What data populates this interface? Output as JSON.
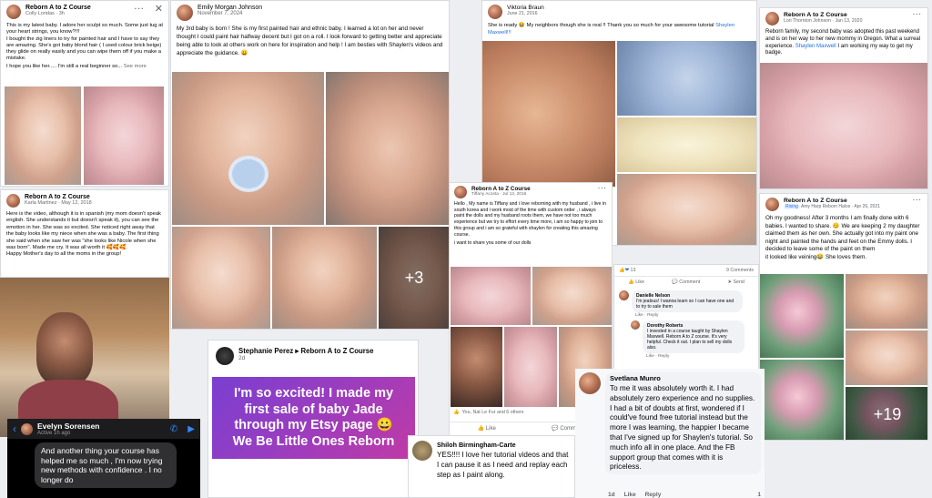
{
  "p1": {
    "group": "Reborn A to Z Course",
    "author": "Colly Loridas",
    "time": "3h",
    "text": "This is my latest baby. I adore her sculpt so much. Some just tug at your heart strings, you know?!!!\nI bought the zig liners to try for painted hair and I have to say they are amazing. She's got baby blond  hair ( I used colour brick beige) they glide on really easily and you can wipe them off if you make a mistake.",
    "text2": "I hope you like her..... I'm still a real beginner so...",
    "see_more": "See more"
  },
  "p2": {
    "author": "Emily Morgan Johnson",
    "time": "November 7, 2024",
    "text": "My 3rd baby is born !  She is my first painted hair and ethnic baby. I learned a lot on her and never thought I could paint hair halfway decent but I got on a roll. I look forward to getting better and appreciate being able to look at others work on here for inspiration and help ! I am besties with Shaylen's videos and appreciate the guidance. 😀",
    "more_count": "+3"
  },
  "p3": {
    "author": "Viktoria Braun",
    "time": "June 21, 2016",
    "text": "She is ready 😆 My neighbors though she is real !! Thank you so much for your awesome tutorial",
    "link": "Shaylen Maxwell!!!"
  },
  "p4": {
    "group": "Reborn A to Z Course",
    "author": "Lori Thornton Johnson",
    "time": "Jan 13, 2020",
    "text": "Reborn family, my second baby was adopted this past weekend and is on her way to her new mommy in Oregon.  What a surreal experience.",
    "link": "Shaylen Maxwell",
    "text2": "I am working my way to get my badge."
  },
  "p5": {
    "group": "Reborn A to Z Course",
    "author": "Karla Martinez",
    "time": "May 12, 2018",
    "text": "Here is the video, although it is in spanish (my mom doesn't speak english. She understands it but doesn't speak it), you can see the emotion in her. She was so excited. She noticed right away that the baby looks like my niece when she was a baby. The first thing she said when she saw her was \"she looks like Nicole when she was born\". Made me cry. It was all worth it 🥰🥰🥰.\nHappy Mother's day to all the moms in the group!"
  },
  "p6": {
    "group": "Reborn A to Z Course",
    "author": "Tiffany Acosta",
    "time": "Jul 13, 2016",
    "text": "Hello , My name is Tiffany and i love reborning with my husband , i live in south korea and i work most of the time with custom order , i always paint the dolls and my husband roots them, we  have not too much experience but we try to effort every time more, i am so happy to join to this group and i am so grateful with shaylen for creating this amazing course.",
    "text2": "i want to share you some of our dolls",
    "reactions": "You, Nat Le Fur and 6 others",
    "like": "Like",
    "comment": "Comment"
  },
  "p7": {
    "reactions": "13",
    "comments": "9 Comments",
    "like": "Like",
    "comment": "Comment",
    "send": "Send",
    "c1_name": "Danielle Nelson",
    "c1_text": "I'm jealous!  I wanna learn so I can have one and to try to sale them",
    "c1_like": "Like",
    "c1_reply": "Reply",
    "c2_name": "Dorothy Roberts",
    "c2_text": "I invested in a course taught by Shaylen Maxwell. Reborn A to Z course. It's very helpful. Check it out. I plan to sell my dolls also.",
    "c2_like": "Like",
    "c2_reply": "Reply"
  },
  "p8": {
    "group": "Reborn A to Z Course",
    "badge": "Rising",
    "author": "Amy Harp Reborn Halos",
    "time": "Apr 26, 2021",
    "text": "Oh my goodness! After 3 months I am finally done with 6 babies. I wanted to share. 😊 We are keeping 2 my daughter claimed them as her own. She actually got into my paint one night and painted the hands and feet on the Emmy dolls. I decided to leave some of the paint on them\nit looked like veining😂 She loves them.",
    "more_count": "+19"
  },
  "p9": {
    "author": "Stephanie Perez",
    "group": "Reborn A to Z Course",
    "time": "2d",
    "text": "I'm so excited! I made my first sale of baby Jade through my Etsy page 😀 We Be Little Ones Reborn"
  },
  "p10": {
    "name": "Evelyn Sorensen",
    "status": "Active 1h ago",
    "text": "And another thing your course has helped me so much ,  I'm now trying new methods with confidence . I no longer do"
  },
  "p11": {
    "author": "Shiloh Birmingham-Carte",
    "text": "YES!!!!  I love her tutorial videos and that I can pause it as I need and replay each step as I paint along."
  },
  "p12": {
    "author": "Svetlana Munro",
    "text": "To me it was absolutely worth it. I had absolutely zero experience and no supplies. I had a bit of doubts at first, wondered if I could've found free tutorial instead but the more I was learning, the happier I became that I've signed up for Shaylen's tutorial. So much info all in one place. And the FB support group that comes with it is priceless.",
    "time": "1d",
    "like": "Like",
    "reply": "Reply",
    "count": "1"
  },
  "colors": {
    "link": "#216fdb",
    "purple": "#7a3fd0",
    "magenta": "#c03aa5",
    "text": "#050505",
    "meta": "#65676b"
  }
}
